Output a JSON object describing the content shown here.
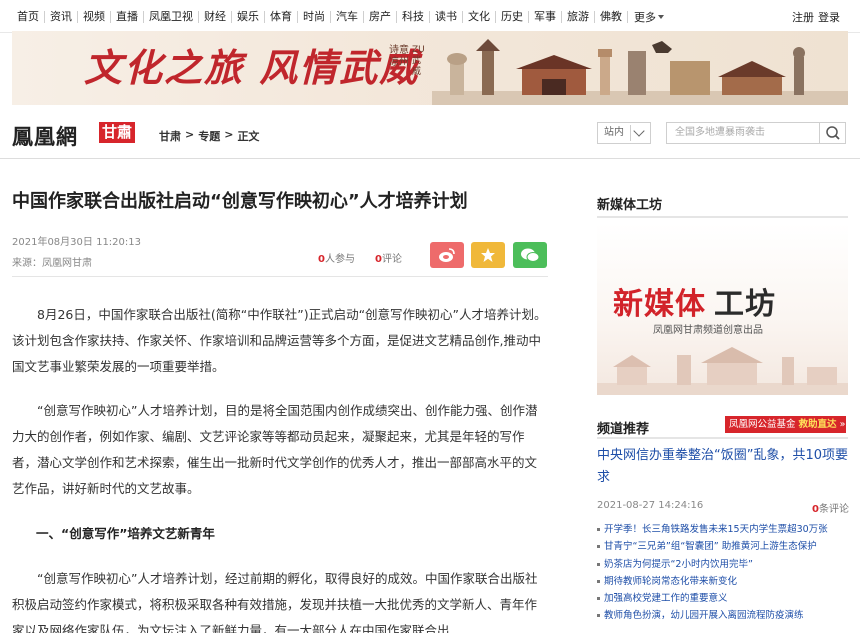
{
  "topnav": {
    "items": [
      "首页",
      "资讯",
      "视频",
      "直播",
      "凤凰卫视",
      "财经",
      "娱乐",
      "体育",
      "时尚",
      "汽车",
      "房产",
      "科技",
      "读书",
      "文化",
      "历史",
      "军事",
      "旅游",
      "佛教"
    ],
    "more": "更多",
    "register": "注册",
    "login": "登录"
  },
  "banner": {
    "title": "文化之旅 风情武威",
    "sub_vertical": "诗意凉州",
    "sub_small": "ZU武威"
  },
  "header": {
    "logo": "鳳凰網",
    "region": "甘肅",
    "breadcrumb": [
      "甘肃",
      ">",
      "专题",
      ">",
      "正文"
    ],
    "site_select": "站内",
    "search_placeholder": "全国多地遭暴雨袭击"
  },
  "article": {
    "title": "中国作家联合出版社启动“创意写作映初心”人才培养计划",
    "date": "2021年08月30日 11:20:13",
    "source": "来源：凤凰网甘肃",
    "participants_count": "0",
    "participants_label": "人参与",
    "comments_count": "0",
    "comments_label": "评论",
    "p1": "8月26日，中国作家联合出版社(简称“中作联社”)正式启动“创意写作映初心”人才培养计划。该计划包含作家扶持、作家关怀、作家培训和品牌运营等多个方面，是促进文艺精品创作,推动中国文艺事业繁荣发展的一项重要举措。",
    "p2": "“创意写作映初心”人才培养计划，目的是将全国范围内创作成绩突出、创作能力强、创作潜力大的创作者，例如作家、编剧、文艺评论家等等都动员起来，凝聚起来，尤其是年轻的写作者，潜心文学创作和艺术探索，催生出一批新时代文学创作的优秀人才，推出一部部高水平的文艺作品，讲好新时代的文艺故事。",
    "section1": "一、“创意写作”培养文艺新青年",
    "p3": "“创意写作映初心”人才培养计划，经过前期的孵化，取得良好的成效。中国作家联合出版社积极启动签约作家模式，将积极采取各种有效措施，发现并扶植一大批优秀的文学新人、青年作家以及网络作家队伍，为文坛注入了新鲜力量，有一大部分人在中国作家联合出"
  },
  "sidebar": {
    "media_heading": "新媒体工坊",
    "media_title_red": "新媒体",
    "media_title_dark": "工坊",
    "media_sub": "凤凰网甘肃频道创意出品",
    "recommend_heading": "频道推荐",
    "promo_text": "凤凰网公益基金",
    "promo_go": "救助直达",
    "headline": "中央网信办重拳整治“饭圈”乱象，共10项要求",
    "headline_time": "2021-08-27 14:24:16",
    "headline_comments": "0",
    "headline_comments_label": "条评论",
    "news": [
      "开学季！长三角铁路发售未来15天内学生票超30万张",
      "甘青宁“三兄弟”组“智囊团” 助推黄河上游生态保护",
      "奶茶店为何提示“2小时内饮用完毕”",
      "期待教师轮岗常态化带来新变化",
      "加强高校党建工作的重要意义",
      "教师角色扮演，幼儿园开展入离园流程防疫演练"
    ]
  },
  "colors": {
    "brand_red": "#d7252b",
    "link_blue": "#1f4fa8"
  }
}
